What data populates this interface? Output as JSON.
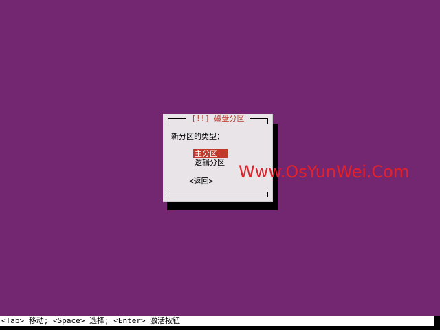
{
  "dialog": {
    "title": "[!!] 磁盘分区",
    "prompt": "新分区的类型：",
    "options": [
      {
        "label": "主分区",
        "selected": true
      },
      {
        "label": "逻辑分区",
        "selected": false
      }
    ],
    "back_label": "<返回>"
  },
  "watermark": "Www.OsYunWei.Com",
  "statusbar": {
    "hint": "<Tab> 移动; <Space> 选择; <Enter> 激活按钮"
  },
  "colors": {
    "background": "#722770",
    "dialog": "#e8e4e8",
    "accent": "#c0392b",
    "watermark": "#e3212b"
  }
}
